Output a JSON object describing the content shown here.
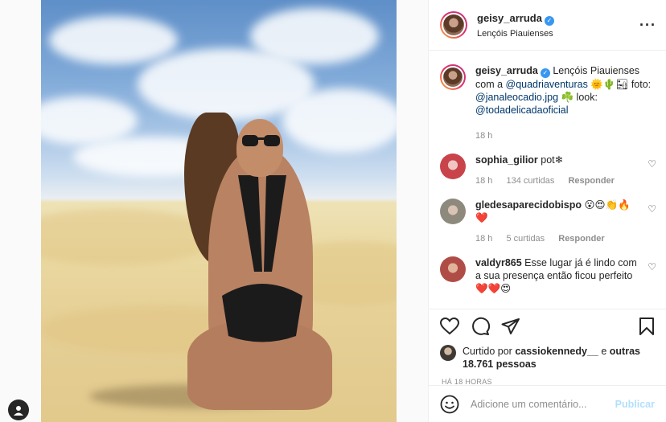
{
  "post": {
    "author": "geisy_arruda",
    "location": "Lençóis Piauienses",
    "caption": {
      "text1": "Lençóis Piauienses com a ",
      "mention1": "@quadriaventuras",
      "emojis1": " 🌞🌵🏜 ",
      "text2": "foto: ",
      "mention2": "@janaleocadio.jpg",
      "text3": " ☘️ look: ",
      "mention3": "@todadelicadaoficial",
      "time": "18 h"
    }
  },
  "comments": [
    {
      "user": "sophia_gilior",
      "text": "pot❄",
      "time": "18 h",
      "likes": "134 curtidas",
      "reply": "Responder",
      "avatar_color": "#c8434a"
    },
    {
      "user": "gledesaparecidobispo",
      "text": "😮😍👏🔥❤️",
      "time": "18 h",
      "likes": "5 curtidas",
      "reply": "Responder",
      "avatar_color": "#8d8a7d"
    },
    {
      "user": "valdyr865",
      "text": "Esse lugar já é lindo com a sua presença então ficou perfeito ❤️❤️😍",
      "time": "",
      "likes": "",
      "reply": "",
      "avatar_color": "#b04c46"
    }
  ],
  "likes": {
    "prefix": "Curtido por ",
    "user": "cassiokennedy__",
    "middle": " e ",
    "others": "outras 18.761 pessoas"
  },
  "timestamp": "HÁ 18 HORAS",
  "compose": {
    "placeholder": "Adicione um comentário...",
    "post_label": "Publicar"
  },
  "icons": [
    "heart-icon",
    "comment-icon",
    "share-icon",
    "bookmark-icon",
    "emoji-icon",
    "more-icon",
    "verified-icon"
  ]
}
